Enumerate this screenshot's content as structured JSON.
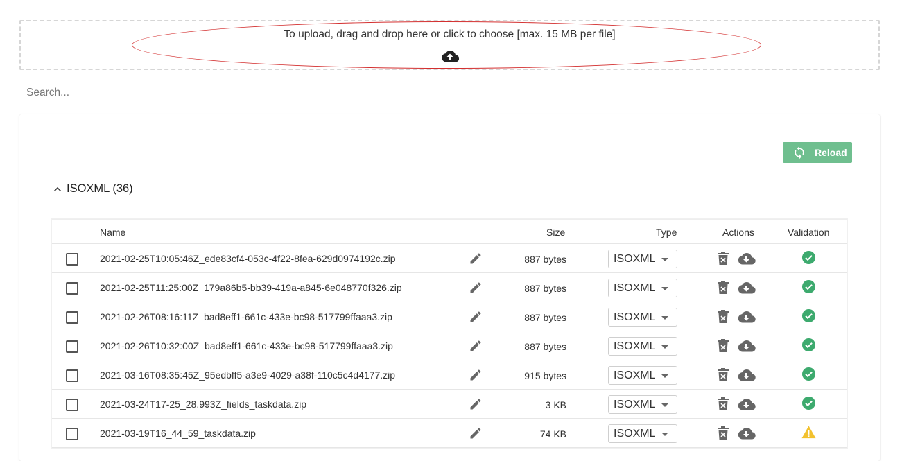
{
  "dropzone": {
    "text": "To upload, drag and drop here or click to choose [max. 15 MB per file]",
    "icon": "cloud-upload-icon"
  },
  "search": {
    "placeholder": "Search..."
  },
  "reload": {
    "label": "Reload",
    "icon": "refresh-icon",
    "color": "#6fbf8f"
  },
  "section": {
    "title": "ISOXML (36)"
  },
  "table": {
    "headers": {
      "name": "Name",
      "size": "Size",
      "type": "Type",
      "actions": "Actions",
      "validation": "Validation"
    },
    "rows": [
      {
        "name": "2021-02-25T10:05:46Z_ede83cf4-053c-4f22-8fea-629d0974192c.zip",
        "size": "887 bytes",
        "type": "ISOXML",
        "validation": "valid"
      },
      {
        "name": "2021-02-25T11:25:00Z_179a86b5-bb39-419a-a845-6e048770f326.zip",
        "size": "887 bytes",
        "type": "ISOXML",
        "validation": "valid"
      },
      {
        "name": "2021-02-26T08:16:11Z_bad8eff1-661c-433e-bc98-517799ffaaa3.zip",
        "size": "887 bytes",
        "type": "ISOXML",
        "validation": "valid"
      },
      {
        "name": "2021-02-26T10:32:00Z_bad8eff1-661c-433e-bc98-517799ffaaa3.zip",
        "size": "887 bytes",
        "type": "ISOXML",
        "validation": "valid"
      },
      {
        "name": "2021-03-16T08:35:45Z_95edbff5-a3e9-4029-a38f-110c5c4d4177.zip",
        "size": "915 bytes",
        "type": "ISOXML",
        "validation": "valid"
      },
      {
        "name": "2021-03-24T17-25_28.993Z_fields_taskdata.zip",
        "size": "3 KB",
        "type": "ISOXML",
        "validation": "valid"
      },
      {
        "name": "2021-03-19T16_44_59_taskdata.zip",
        "size": "74 KB",
        "type": "ISOXML",
        "validation": "warning"
      }
    ]
  },
  "colors": {
    "valid": "#3daa6e",
    "warning": "#f2c12e",
    "icon_gray": "#666666",
    "annotation": "#d32f2f"
  }
}
